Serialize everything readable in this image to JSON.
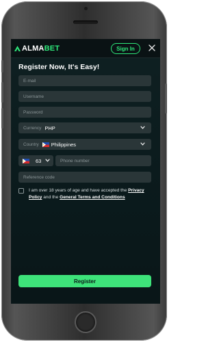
{
  "header": {
    "logo_left": "ALMA",
    "logo_right": "BET",
    "signin_label": "Sign In",
    "close_icon": "close-icon"
  },
  "form": {
    "title": "Register Now, It's Easy!",
    "email_placeholder": "E-mail",
    "username_placeholder": "Username",
    "password_placeholder": "Password",
    "currency": {
      "label": "Currency",
      "value": "PHP"
    },
    "country": {
      "label": "Country",
      "value": "Philippines"
    },
    "phone_code": "63",
    "phone_placeholder": "Phone number",
    "reference_placeholder": "Reference code",
    "terms": {
      "text_before": "I am over 18 years of age and have accepted the ",
      "privacy_link": "Privacy Policy",
      "text_mid": " and the ",
      "terms_link": "General Terms and Conditions"
    },
    "register_label": "Register"
  },
  "colors": {
    "accent": "#2ee87a",
    "background": "#0b1b1d",
    "field": "#2a3638"
  }
}
